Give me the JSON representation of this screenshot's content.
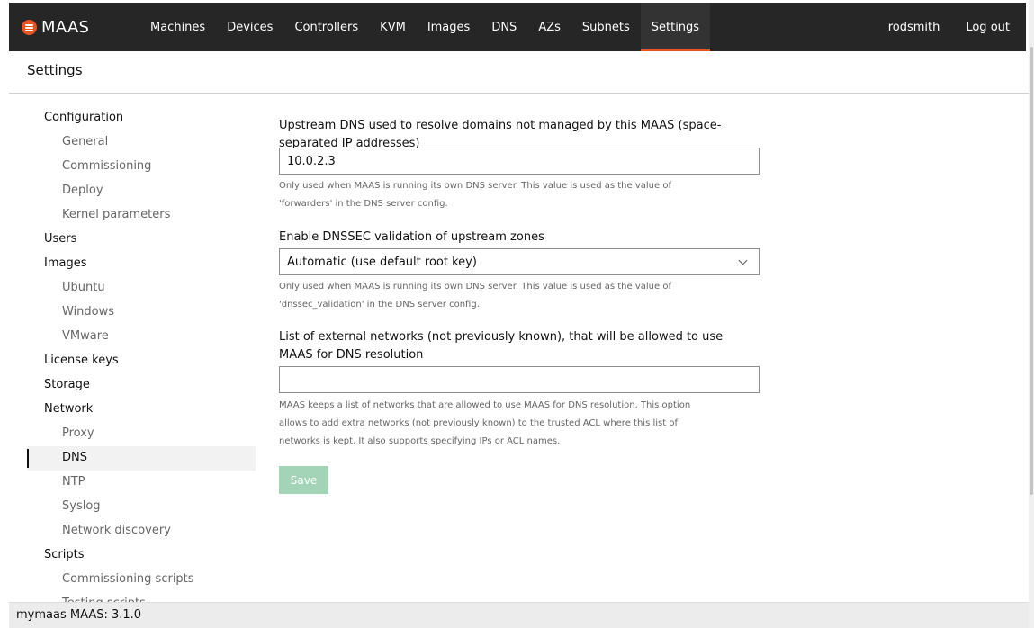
{
  "nav": {
    "brand": "MAAS",
    "items": [
      {
        "label": "Machines"
      },
      {
        "label": "Devices"
      },
      {
        "label": "Controllers"
      },
      {
        "label": "KVM"
      },
      {
        "label": "Images"
      },
      {
        "label": "DNS"
      },
      {
        "label": "AZs"
      },
      {
        "label": "Subnets"
      },
      {
        "label": "Settings",
        "active": true
      }
    ],
    "user": "rodsmith",
    "logout": "Log out",
    "accent_color": "#e95420"
  },
  "header": {
    "title": "Settings"
  },
  "sidebar": {
    "items": [
      {
        "label": "Configuration",
        "level": "group"
      },
      {
        "label": "General",
        "level": "sub"
      },
      {
        "label": "Commissioning",
        "level": "sub"
      },
      {
        "label": "Deploy",
        "level": "sub"
      },
      {
        "label": "Kernel parameters",
        "level": "sub"
      },
      {
        "label": "Users",
        "level": "group"
      },
      {
        "label": "Images",
        "level": "group"
      },
      {
        "label": "Ubuntu",
        "level": "sub"
      },
      {
        "label": "Windows",
        "level": "sub"
      },
      {
        "label": "VMware",
        "level": "sub"
      },
      {
        "label": "License keys",
        "level": "group"
      },
      {
        "label": "Storage",
        "level": "group"
      },
      {
        "label": "Network",
        "level": "group"
      },
      {
        "label": "Proxy",
        "level": "sub"
      },
      {
        "label": "DNS",
        "level": "sub",
        "active": true
      },
      {
        "label": "NTP",
        "level": "sub"
      },
      {
        "label": "Syslog",
        "level": "sub"
      },
      {
        "label": "Network discovery",
        "level": "sub"
      },
      {
        "label": "Scripts",
        "level": "group"
      },
      {
        "label": "Commissioning scripts",
        "level": "sub"
      },
      {
        "label": "Testing scripts",
        "level": "sub"
      }
    ]
  },
  "form": {
    "upstream_dns": {
      "label": "Upstream DNS used to resolve domains not managed by this MAAS (space-separated IP addresses)",
      "value": "10.0.2.3",
      "help": "Only used when MAAS is running its own DNS server. This value is used as the value of 'forwarders' in the DNS server config."
    },
    "dnssec": {
      "label": "Enable DNSSEC validation of upstream zones",
      "selected": "Automatic (use default root key)",
      "help": "Only used when MAAS is running its own DNS server. This value is used as the value of 'dnssec_validation' in the DNS server config."
    },
    "external_networks": {
      "label": "List of external networks (not previously known), that will be allowed to use MAAS for DNS resolution",
      "value": "",
      "help": "MAAS keeps a list of networks that are allowed to use MAAS for DNS resolution. This option allows to add extra networks (not previously known) to the trusted ACL where this list of networks is kept. It also supports specifying IPs or ACL names."
    },
    "save_label": "Save"
  },
  "footer": {
    "name": "mymaas MAAS:",
    "version": "3.1.0"
  }
}
